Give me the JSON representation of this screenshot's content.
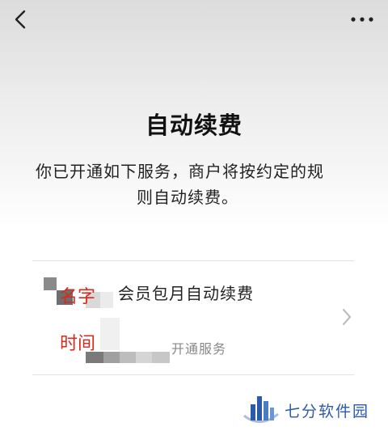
{
  "header": {
    "back_icon": "chevron-left-icon",
    "more_icon": "more-horizontal-icon"
  },
  "page": {
    "title": "自动续费",
    "description_line1": "你已开通如下服务，商户将按约定的规",
    "description_line2": "则自动续费。"
  },
  "service": {
    "overlay_name": "名字",
    "overlay_time": "时间",
    "name": "会员包月自动续费",
    "status": "开通服务",
    "chevron_icon": "chevron-right-icon"
  },
  "watermark": {
    "text": "七分软件园",
    "color": "#2b5aa8"
  },
  "colors": {
    "annotation_red": "#d62a1b",
    "secondary_text": "#888888"
  }
}
